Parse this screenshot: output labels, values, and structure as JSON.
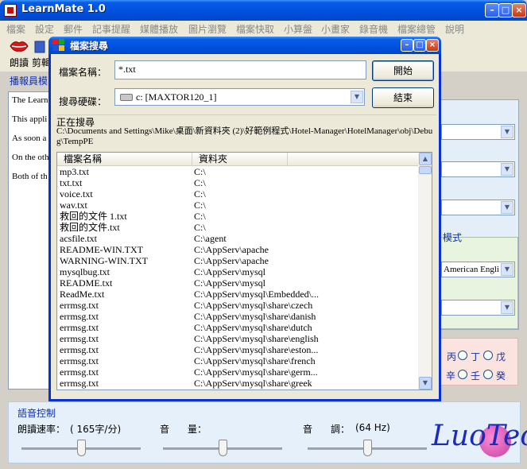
{
  "app": {
    "title": "LearnMate 1.0"
  },
  "menu": [
    "檔案",
    "設定",
    "郵件",
    "記事提醒",
    "媒體播放",
    "圖片瀏覽",
    "檔案快取",
    "小算盤",
    "小畫家",
    "錄音機",
    "檔案總管",
    "說明"
  ],
  "toolbar": {
    "read_label": "朗讀",
    "cut_label": "剪輯",
    "broadcast_label": "播報員模"
  },
  "text_panel": [
    "The Learn choosing file.",
    "This appli speech fro operation mode. Yo selecting t",
    "As soon a spoken by may selec",
    "On the oth converted audio file",
    "Both of th screen. Ar you the e-"
  ],
  "right_panel": {
    "mode_label": "模式",
    "voice_select": "American Engli",
    "radio_row1": [
      "丙",
      "丁",
      "戊"
    ],
    "radio_row2": [
      "辛",
      "壬",
      "癸"
    ]
  },
  "voice_control": {
    "title": "語音控制",
    "rate_label": "朗讀速率：",
    "rate_value": "( 165字/分)",
    "volume_label_a": "音",
    "volume_label_b": "量：",
    "pitch_label_a": "音",
    "pitch_label_b": "調：",
    "pitch_value": "(64  Hz)",
    "rate_level": 0.5,
    "volume_level": 0.5,
    "pitch_level": 0.5
  },
  "logo": "LuoTec",
  "dialog": {
    "title": "檔案搜尋",
    "filename_label": "檔案名稱：",
    "filename_value": "*.txt",
    "drive_label": "搜尋硬碟：",
    "drive_value": "c: [MAXTOR120_1]",
    "search_button": "開始",
    "end_button": "結束",
    "progress_title": "正在搜尋",
    "progress_path": "C:\\Documents and Settings\\Mike\\桌面\\新資料夾 (2)\\好範例程式\\Hotel-Manager\\HotelManager\\obj\\Debug\\TempPE",
    "columns": [
      "檔案名稱",
      "資料夾"
    ],
    "rows": [
      [
        "mp3.txt",
        "C:\\"
      ],
      [
        "txt.txt",
        "C:\\"
      ],
      [
        "voice.txt",
        "C:\\"
      ],
      [
        "wav.txt",
        "C:\\"
      ],
      [
        "救回的文件 1.txt",
        "C:\\"
      ],
      [
        "救回的文件.txt",
        "C:\\"
      ],
      [
        "acsfile.txt",
        "C:\\agent"
      ],
      [
        "README-WIN.TXT",
        "C:\\AppServ\\apache"
      ],
      [
        "WARNING-WIN.TXT",
        "C:\\AppServ\\apache"
      ],
      [
        "mysqlbug.txt",
        "C:\\AppServ\\mysql"
      ],
      [
        "README.txt",
        "C:\\AppServ\\mysql"
      ],
      [
        "ReadMe.txt",
        "C:\\AppServ\\mysql\\Embedded\\..."
      ],
      [
        "errmsg.txt",
        "C:\\AppServ\\mysql\\share\\czech"
      ],
      [
        "errmsg.txt",
        "C:\\AppServ\\mysql\\share\\danish"
      ],
      [
        "errmsg.txt",
        "C:\\AppServ\\mysql\\share\\dutch"
      ],
      [
        "errmsg.txt",
        "C:\\AppServ\\mysql\\share\\english"
      ],
      [
        "errmsg.txt",
        "C:\\AppServ\\mysql\\share\\eston..."
      ],
      [
        "errmsg.txt",
        "C:\\AppServ\\mysql\\share\\french"
      ],
      [
        "errmsg.txt",
        "C:\\AppServ\\mysql\\share\\germ..."
      ],
      [
        "errmsg.txt",
        "C:\\AppServ\\mysql\\share\\greek"
      ]
    ]
  },
  "colors": {
    "titlebar": "#0052e0",
    "accent_text": "#1030a8",
    "window_bg": "#ece9d8"
  }
}
